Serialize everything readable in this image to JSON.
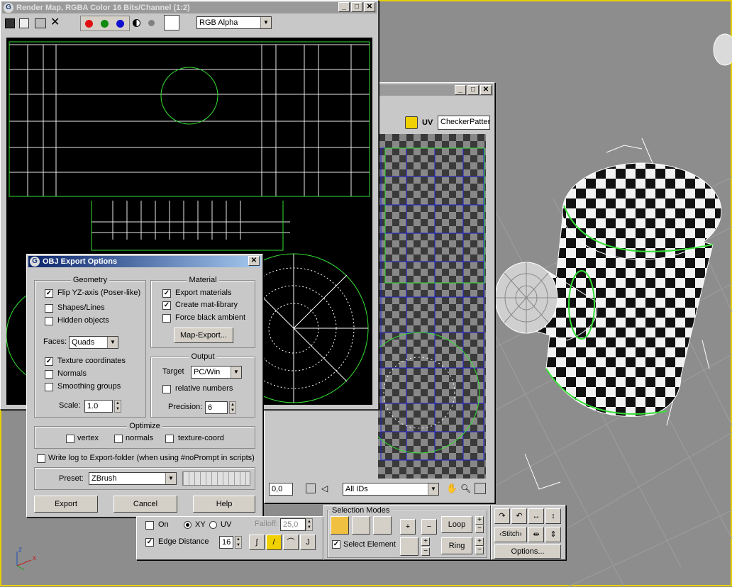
{
  "render_map": {
    "title": "Render Map, RGBA Color 16 Bits/Channel (1:2)",
    "channel_select": "RGB Alpha"
  },
  "uv_editor": {
    "uv_label": "UV",
    "texture_select": "CheckerPattern",
    "coord_value": "0,0",
    "ids_select": "All IDs"
  },
  "obj_export": {
    "title": "OBJ Export Options",
    "geometry": {
      "title": "Geometry",
      "flip_yz": "Flip YZ-axis (Poser-like)",
      "shapes_lines": "Shapes/Lines",
      "hidden_objects": "Hidden objects",
      "faces_label": "Faces:",
      "faces_value": "Quads",
      "texture_coords": "Texture coordinates",
      "normals": "Normals",
      "smoothing_groups": "Smoothing groups",
      "scale_label": "Scale:",
      "scale_value": "1.0"
    },
    "material": {
      "title": "Material",
      "export_materials": "Export materials",
      "create_mat_library": "Create mat-library",
      "force_black_ambient": "Force black ambient",
      "map_export": "Map-Export..."
    },
    "output": {
      "title": "Output",
      "target_label": "Target",
      "target_value": "PC/Win",
      "relative_numbers": "relative numbers",
      "precision_label": "Precision:",
      "precision_value": "6"
    },
    "optimize": {
      "title": "Optimize",
      "vertex": "vertex",
      "normals": "normals",
      "texture_coord": "texture-coord"
    },
    "write_log": "Write log to Export-folder (when using #noPrompt in scripts)",
    "preset_label": "Preset:",
    "preset_value": "ZBrush",
    "export_button": "Export",
    "cancel_button": "Cancel",
    "help_button": "Help"
  },
  "soft_selection": {
    "on": "On",
    "xy": "XY",
    "uv": "UV",
    "falloff_label": "Falloff:",
    "falloff_value": "25,0",
    "edge_distance": "Edge Distance",
    "edge_value": "16"
  },
  "selection_modes": {
    "title": "Selection Modes",
    "select_element": "Select Element",
    "loop": "Loop",
    "ring": "Ring",
    "stitch": "Stitch",
    "options": "Options..."
  },
  "axis": {
    "z": "z",
    "x": "x",
    "y": "y"
  }
}
